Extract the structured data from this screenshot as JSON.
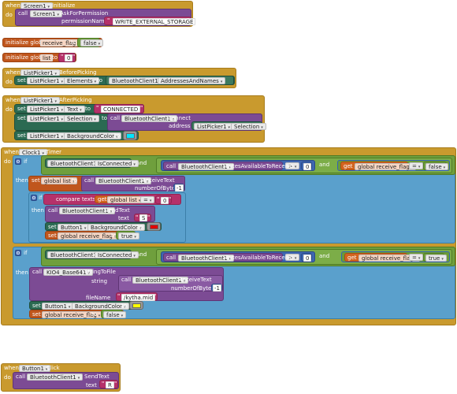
{
  "blocks": {
    "screen_init": {
      "when": "when",
      "component": "Screen1",
      "event": "Initialize",
      "do": "do",
      "call": "call",
      "call_component": "Screen1",
      "method": "AskForPermission",
      "param_label": "permissionName",
      "permission_value": "WRITE_EXTERNAL_STORAGE"
    },
    "global_receive_flag": {
      "init": "initialize global",
      "name": "receive_flag",
      "to": "to",
      "value": "false"
    },
    "global_list": {
      "init": "initialize global",
      "name": "list",
      "to": "to",
      "value": "0"
    },
    "before_picking": {
      "when": "when",
      "component": "ListPicker1",
      "event": "BeforePicking",
      "do": "do",
      "set": "set",
      "set_component": "ListPicker1",
      "property": "Elements",
      "to": "to",
      "value_component": "BluetoothClient1",
      "value_property": "AddressesAndNames"
    },
    "after_picking": {
      "when": "when",
      "component": "ListPicker1",
      "event": "AfterPicking",
      "do": "do",
      "set": "set",
      "set1_component": "ListPicker1",
      "set1_property": "Text",
      "to": "to",
      "set1_value": "CONNECTED",
      "set2_component": "ListPicker1",
      "set2_property": "Selection",
      "call": "call",
      "call_component": "BluetoothClient1",
      "call_method": "Connect",
      "address_label": "address",
      "address_component": "ListPicker1",
      "address_property": "Selection",
      "set3_component": "ListPicker1",
      "set3_property": "BackgroundColor",
      "set3_color": "#00e5ff"
    },
    "clock_timer": {
      "when": "when",
      "component": "Clock1",
      "event": "Timer",
      "do": "do",
      "if": "if",
      "then": "then",
      "and": "and",
      "call": "call",
      "set": "set",
      "to": "to",
      "get": "get",
      "if1_component": "BluetoothClient1",
      "if1_property": "IsConnected",
      "bytes_component": "BluetoothClient1",
      "bytes_method": "BytesAvailableToReceive",
      "gt_op": ">",
      "zero": "0",
      "flag_var": "global receive_flag",
      "eq_op": "=",
      "false_val": "false",
      "set_list_var": "global list",
      "receive_component": "BluetoothClient1",
      "receive_method": "ReceiveText",
      "number_of_bytes_label": "numberOfBytes",
      "minus_one": "-1",
      "compare_label": "compare texts",
      "compare_get": "global list",
      "compare_op": "=",
      "compare_value": "0",
      "send_component": "BluetoothClient1",
      "send_method": "SendText",
      "text_label": "text",
      "send_value": "S",
      "button_component": "Button1",
      "button_property": "BackgroundColor",
      "button_color_red": "#e00000",
      "flag_set_var": "global receive_flag",
      "true_val": "true",
      "if2_component": "BluetoothClient1",
      "if2_property": "IsConnected",
      "bytes2_component": "BluetoothClient1",
      "bytes2_method": "BytesAvailableToReceive",
      "flag2_var": "global receive_flag",
      "true_val2": "true",
      "file_component": "KIO4_Base641",
      "file_method": "StringToFile",
      "string_label": "string",
      "receive2_component": "BluetoothClient1",
      "receive2_method": "ReceiveText",
      "number_of_bytes2_label": "numberOfBytes",
      "minus_one2": "-1",
      "filename_label": "fileName",
      "filename_value": "/kytha.mid",
      "button2_component": "Button1",
      "button2_property": "BackgroundColor",
      "button_color_yellow": "#ffff00",
      "flag_set2_var": "global receive_flag",
      "false_val2": "false"
    },
    "button_click": {
      "when": "when",
      "component": "Button1",
      "event": "Click",
      "do": "do",
      "call": "call",
      "call_component": "BluetoothClient1",
      "method": "SendText",
      "text_label": "text",
      "value": "R"
    }
  },
  "icons": {
    "dropdown": "triangle-down",
    "mutator": "gear-icon"
  }
}
